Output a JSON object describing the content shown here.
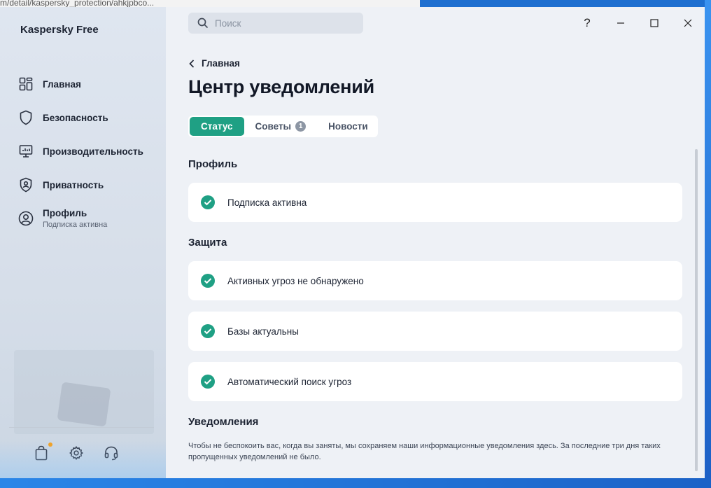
{
  "browser": {
    "url": "m/detail/kaspersky_protection/ahkjpbco..."
  },
  "app": {
    "title": "Kaspersky Free"
  },
  "search": {
    "placeholder": "Поиск"
  },
  "window_controls": {
    "help": "?"
  },
  "sidebar": {
    "items": [
      {
        "label": "Главная",
        "icon": "dashboard-icon"
      },
      {
        "label": "Безопасность",
        "icon": "shield-icon"
      },
      {
        "label": "Производительность",
        "icon": "monitor-icon"
      },
      {
        "label": "Приватность",
        "icon": "privacy-shield-icon"
      },
      {
        "label": "Профиль",
        "sublabel": "Подписка активна",
        "icon": "user-icon"
      }
    ],
    "bottom": [
      "shop-bag-icon",
      "gear-icon",
      "headset-icon"
    ]
  },
  "breadcrumb": {
    "back_label": "Главная"
  },
  "page": {
    "title": "Центр уведомлений"
  },
  "tabs": [
    {
      "label": "Статус",
      "active": true
    },
    {
      "label": "Советы",
      "badge": "1"
    },
    {
      "label": "Новости"
    }
  ],
  "sections": {
    "profile": {
      "title": "Профиль",
      "items": [
        "Подписка активна"
      ]
    },
    "protection": {
      "title": "Защита",
      "items": [
        "Активных угроз не обнаружено",
        "Базы актуальны",
        "Автоматический поиск угроз"
      ]
    },
    "notifications": {
      "title": "Уведомления",
      "text": "Чтобы не беспокоить вас, когда вы заняты, мы сохраняем наши информационные уведомления здесь. За последние три дня таких пропущенных уведомлений не было."
    }
  },
  "colors": {
    "accent": "#1fa084",
    "badge": "#8d96a4",
    "notify_dot": "#f3a020"
  }
}
